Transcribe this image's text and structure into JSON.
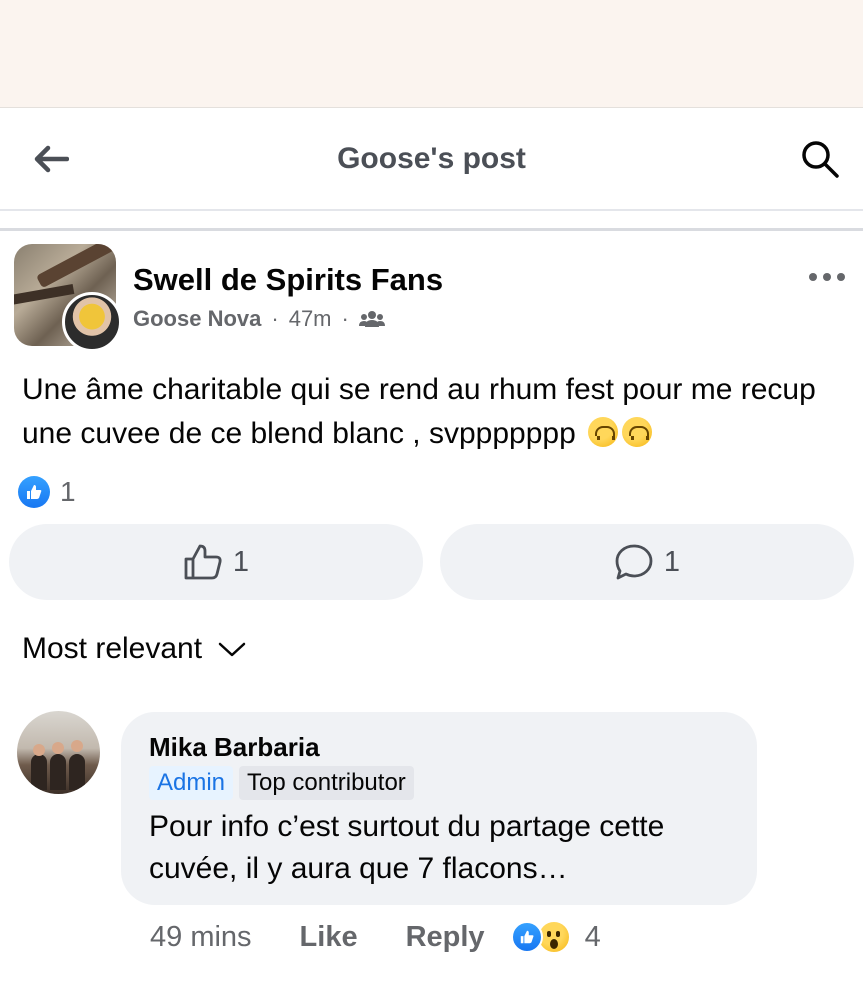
{
  "header": {
    "title": "Goose's post"
  },
  "post": {
    "group_name": "Swell de Spirits Fans",
    "author": "Goose Nova",
    "dot1": "·",
    "time": "47m",
    "dot2": "·",
    "text": "Une âme charitable qui se rend au rhum fest pour me recup une cuvee de ce blend blanc , svppppppp",
    "reaction_count": "1",
    "like_count": "1",
    "comment_count": "1"
  },
  "sort": {
    "label": "Most relevant"
  },
  "comment": {
    "name": "Mika Barbaria",
    "badge_admin": "Admin",
    "badge_top": "Top contributor",
    "text": "Pour info c’est surtout du partage cette cuvée, il y aura que 7 flacons…",
    "time": "49 mins",
    "like_label": "Like",
    "reply_label": "Reply",
    "reaction_count": "4"
  },
  "colors": {
    "accent": "#1877f2",
    "muted": "#65676b",
    "bubble": "#f0f2f5",
    "top_strip": "#fbf4ef"
  },
  "icons": {
    "back": "arrow-left-icon",
    "search": "search-icon",
    "more": "more-horizontal-icon",
    "audience": "members-icon",
    "like": "thumbs-up-icon",
    "comment": "comment-bubble-icon",
    "sort": "chevron-down-icon"
  }
}
